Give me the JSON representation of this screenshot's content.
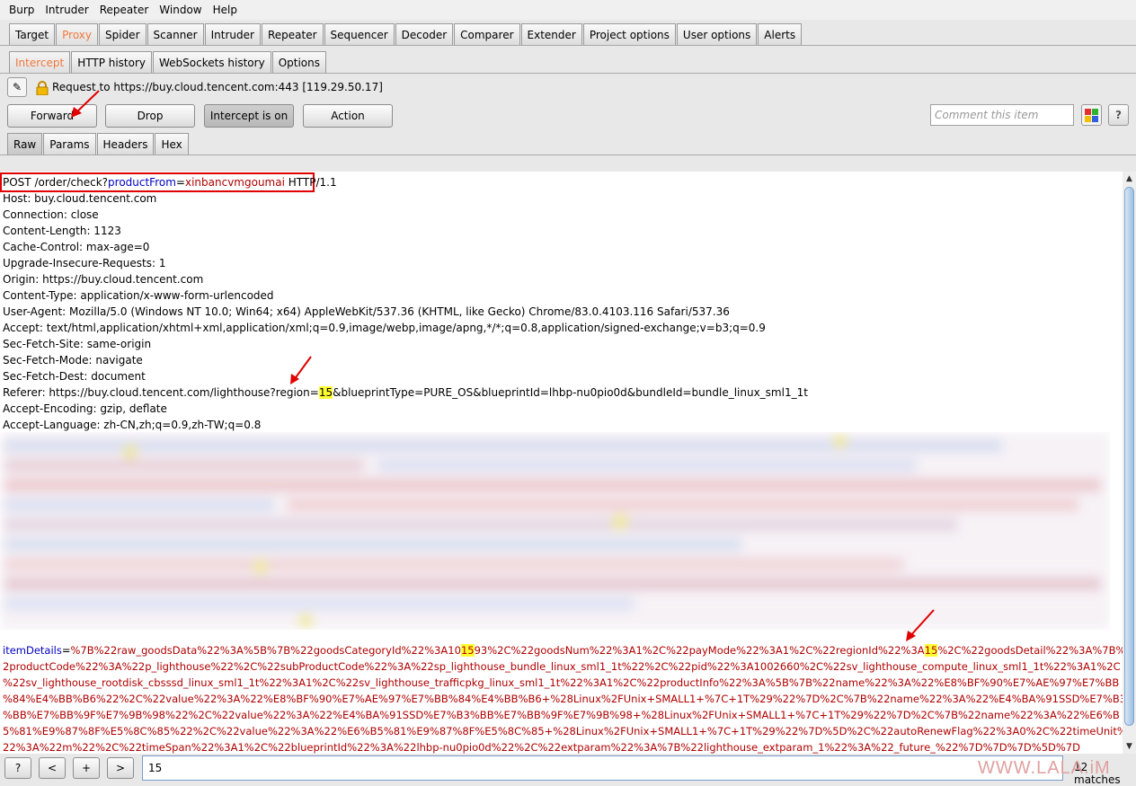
{
  "menu": [
    "Burp",
    "Intruder",
    "Repeater",
    "Window",
    "Help"
  ],
  "main_tabs": [
    "Target",
    "Proxy",
    "Spider",
    "Scanner",
    "Intruder",
    "Repeater",
    "Sequencer",
    "Decoder",
    "Comparer",
    "Extender",
    "Project options",
    "User options",
    "Alerts"
  ],
  "sub_tabs": [
    "Intercept",
    "HTTP history",
    "WebSockets history",
    "Options"
  ],
  "request_info": "Request to https://buy.cloud.tencent.com:443  [119.29.50.17]",
  "buttons": {
    "forward": "Forward",
    "drop": "Drop",
    "intercept": "Intercept is on",
    "action": "Action"
  },
  "comment_placeholder": "Comment this item",
  "help": "?",
  "view_tabs": [
    "Raw",
    "Params",
    "Headers",
    "Hex"
  ],
  "request_line": {
    "method_path": "POST /order/check?",
    "param": "productFrom",
    "eq": "=",
    "value": "xinbancvmgoumai",
    "proto": " HTTP/1.1"
  },
  "headers": [
    "Host: buy.cloud.tencent.com",
    "Connection: close",
    "Content-Length: 1123",
    "Cache-Control: max-age=0",
    "Upgrade-Insecure-Requests: 1",
    "Origin: https://buy.cloud.tencent.com",
    "Content-Type: application/x-www-form-urlencoded",
    "User-Agent: Mozilla/5.0 (Windows NT 10.0; Win64; x64) AppleWebKit/537.36 (KHTML, like Gecko) Chrome/83.0.4103.116 Safari/537.36",
    "Accept: text/html,application/xhtml+xml,application/xml;q=0.9,image/webp,image/apng,*/*;q=0.8,application/signed-exchange;v=b3;q=0.9",
    "Sec-Fetch-Site: same-origin",
    "Sec-Fetch-Mode: navigate",
    "Sec-Fetch-Dest: document"
  ],
  "referer": {
    "pre": "Referer: https://buy.cloud.tencent.com/lighthouse?region=",
    "hl": "15",
    "post": "&blueprintType=PURE_OS&blueprintId=lhbp-nu0pio0d&bundleId=bundle_linux_sml1_1t"
  },
  "headers2": [
    "Accept-Encoding: gzip, deflate",
    "Accept-Language: zh-CN,zh;q=0.9,zh-TW;q=0.8"
  ],
  "body_line1": {
    "name": "itemDetails",
    "eq": "=",
    "a": "%7B%22raw_goodsData%22%3A%5B%7B%22goodsCategoryId%22%3A10",
    "hl1": "15",
    "b": "93%2C%22goodsNum%22%3A1%2C%22payMode%22%3A1%2C%22regionId%22%3A",
    "hl2": "15",
    "c": "%2C%22goodsDetail%22%3A%7B%2"
  },
  "body_lines": [
    "2productCode%22%3A%22p_lighthouse%22%2C%22subProductCode%22%3A%22sp_lighthouse_bundle_linux_sml1_1t%22%2C%22pid%22%3A1002660%2C%22sv_lighthouse_compute_linux_sml1_1t%22%3A1%2C",
    "%22sv_lighthouse_rootdisk_cbsssd_linux_sml1_1t%22%3A1%2C%22sv_lighthouse_trafficpkg_linux_sml1_1t%22%3A1%2C%22productInfo%22%3A%5B%7B%22name%22%3A%22%E8%BF%90%E7%AE%97%E7%BB",
    "%84%E4%BB%B6%22%2C%22value%22%3A%22%E8%BF%90%E7%AE%97%E7%BB%84%E4%BB%B6+%28Linux%2FUnix+SMALL1+%7C+1T%29%22%7D%2C%7B%22name%22%3A%22%E4%BA%91SSD%E7%B3",
    "%BB%E7%BB%9F%E7%9B%98%22%2C%22value%22%3A%22%E4%BA%91SSD%E7%B3%BB%E7%BB%9F%E7%9B%98+%28Linux%2FUnix+SMALL1+%7C+1T%29%22%7D%2C%7B%22name%22%3A%22%E6%B",
    "5%81%E9%87%8F%E5%8C%85%22%2C%22value%22%3A%22%E6%B5%81%E9%87%8F%E5%8C%85+%28Linux%2FUnix+SMALL1+%7C+1T%29%22%7D%5D%2C%22autoRenewFlag%22%3A0%2C%22timeUnit%",
    "22%3A%22m%22%2C%22timeSpan%22%3A1%2C%22blueprintId%22%3A%22lhbp-nu0pio0d%22%2C%22extparam%22%3A%7B%22lighthouse_extparam_1%22%3A%22_future_%22%7D%7D%7D%5D%7D"
  ],
  "search": {
    "value": "15",
    "matches": "12 matches"
  },
  "nav_buttons": [
    "?",
    "<",
    "+",
    ">"
  ],
  "watermark": "WWW.LALA.iM"
}
